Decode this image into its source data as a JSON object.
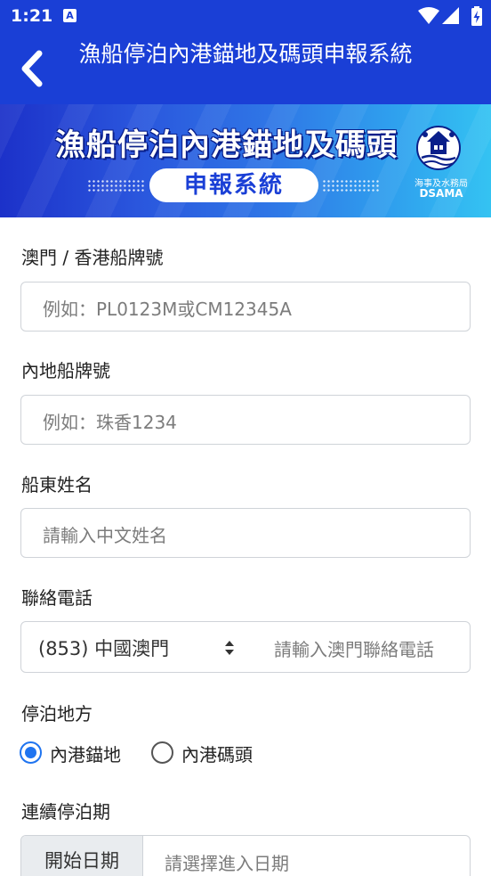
{
  "status_bar": {
    "time": "1:21",
    "notification_icon": "A",
    "icons": [
      "wifi-icon",
      "signal-icon",
      "battery-charging-icon"
    ]
  },
  "app_bar": {
    "back_icon": "chevron-left-icon",
    "title": "漁船停泊內港錨地及碼頭申報系統"
  },
  "banner": {
    "title": "漁船停泊內港錨地及碼頭",
    "subtitle": "申報系統",
    "logo_cn": "海事及水務局",
    "logo_en": "DSAMA"
  },
  "form": {
    "macau_hk_plate": {
      "label": "澳門 / 香港船牌號",
      "placeholder": "例如：PL0123M或CM12345A"
    },
    "mainland_plate": {
      "label": "內地船牌號",
      "placeholder": "例如：珠香1234"
    },
    "owner_name": {
      "label": "船東姓名",
      "placeholder": "請輸入中文姓名"
    },
    "contact_phone": {
      "label": "聯絡電話",
      "region_selected": "(853) 中國澳門",
      "placeholder": "請輸入澳門聯絡電話"
    },
    "berth_location": {
      "label": "停泊地方",
      "options": [
        "內港錨地",
        "內港碼頭"
      ],
      "selected": "內港錨地"
    },
    "berth_period": {
      "label": "連續停泊期",
      "start_addon": "開始日期",
      "start_placeholder": "請選擇進入日期"
    }
  },
  "colors": {
    "primary": "#1a3fd6",
    "radio_checked": "#1f74f0",
    "field_border": "#cfd3d8",
    "addon_background": "#e9ecef"
  }
}
